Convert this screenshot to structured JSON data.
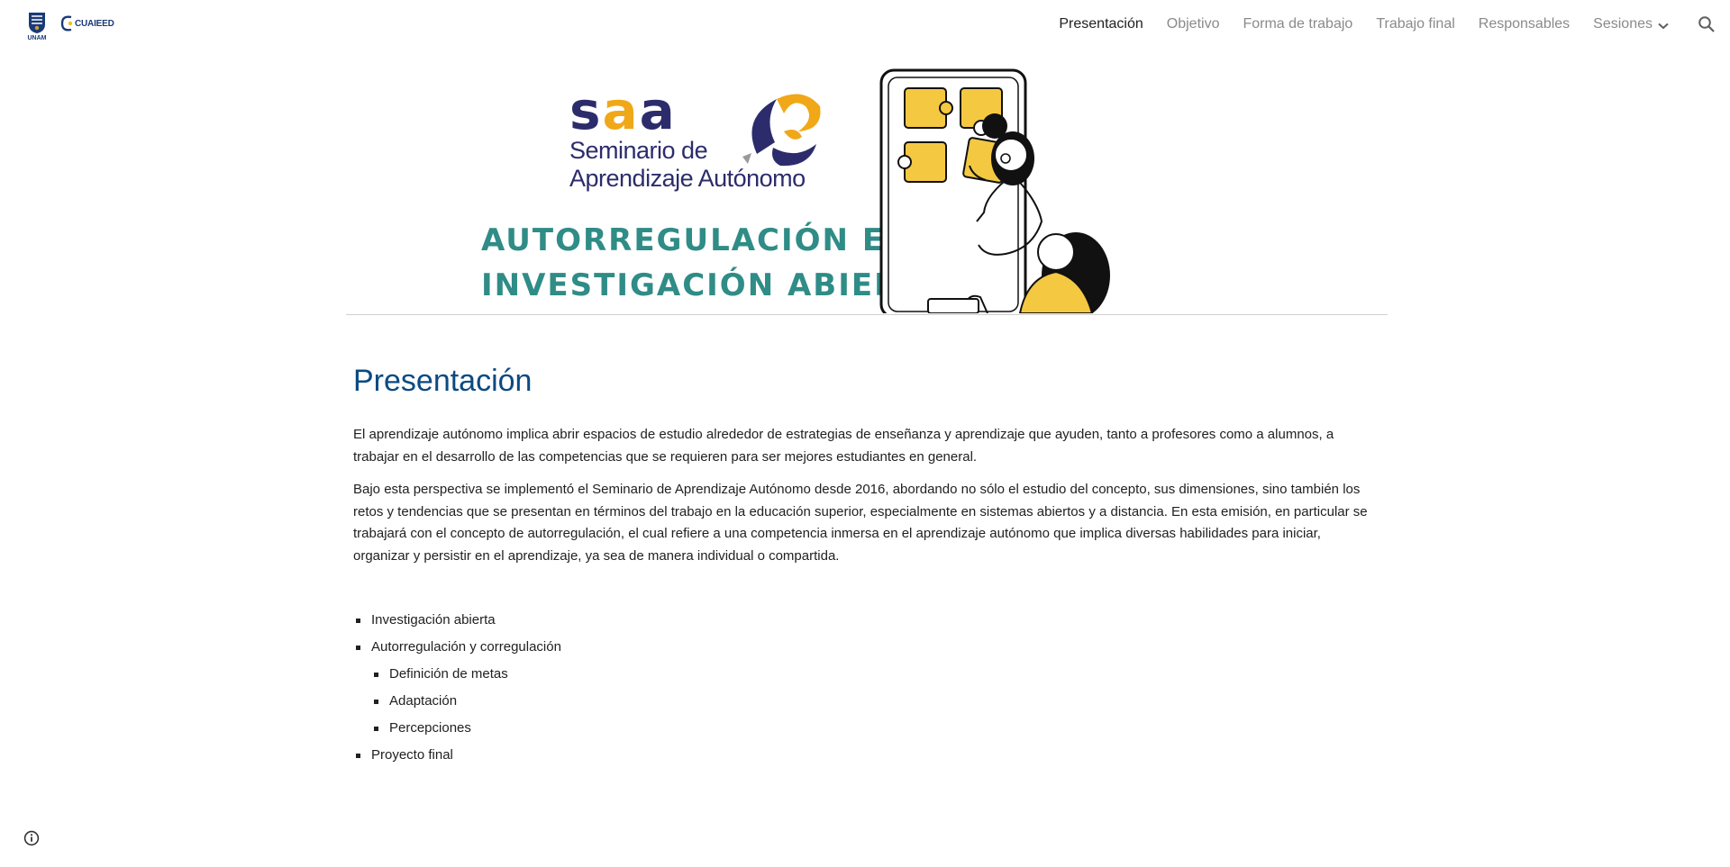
{
  "header": {
    "logo_unam_label": "UNAM",
    "logo_cuaed_label": "CUAIEED"
  },
  "nav": {
    "items": [
      "Presentación",
      "Objetivo",
      "Forma de trabajo",
      "Trabajo final",
      "Responsables"
    ],
    "dropdown_label": "Sesiones",
    "active": "Presentación"
  },
  "banner": {
    "logo_letters": [
      "s",
      "a",
      "a"
    ],
    "logo_line1": "Seminario de",
    "logo_line2": "Aprendizaje Autónomo",
    "title_line1": "AUTORREGULACIÓN E",
    "title_line2": "INVESTIGACIÓN ABIERTA"
  },
  "main": {
    "title": "Presentación",
    "paragraphs": [
      "El aprendizaje autónomo implica abrir espacios de estudio alrededor de estrategias de enseñanza y aprendizaje que ayuden, tanto a profesores como a alumnos, a trabajar en el desarrollo de las competencias que se requieren para ser mejores estudiantes en general.",
      "Bajo esta perspectiva se implementó el Seminario de Aprendizaje Autónomo desde 2016, abordando no sólo el estudio del concepto, sus dimensiones, sino también los retos y tendencias que se presentan en términos del trabajo en la educación superior, especialmente en sistemas abiertos y a distancia. En esta emisión, en particular se trabajará con el concepto de autorregulación, el cual refiere a una competencia inmersa en el aprendizaje autónomo que implica diversas habilidades para iniciar, organizar y persistir en el aprendizaje, ya sea de manera individual o compartida."
    ],
    "topics": [
      {
        "label": "Investigación abierta"
      },
      {
        "label": "Autorregulación y corregulación",
        "children": [
          "Definición de metas",
          "Adaptación",
          "Percepciones"
        ]
      },
      {
        "label": "Proyecto final"
      }
    ]
  },
  "colors": {
    "title_blue": "#0b4a82",
    "navy": "#2c2c6c",
    "gold": "#f0a818",
    "teal": "#2f8c86",
    "puzzle_yellow": "#f5c842"
  },
  "icons": [
    "unam-logo",
    "cuaed-logo",
    "chevron-down-icon",
    "search-icon",
    "info-icon"
  ]
}
